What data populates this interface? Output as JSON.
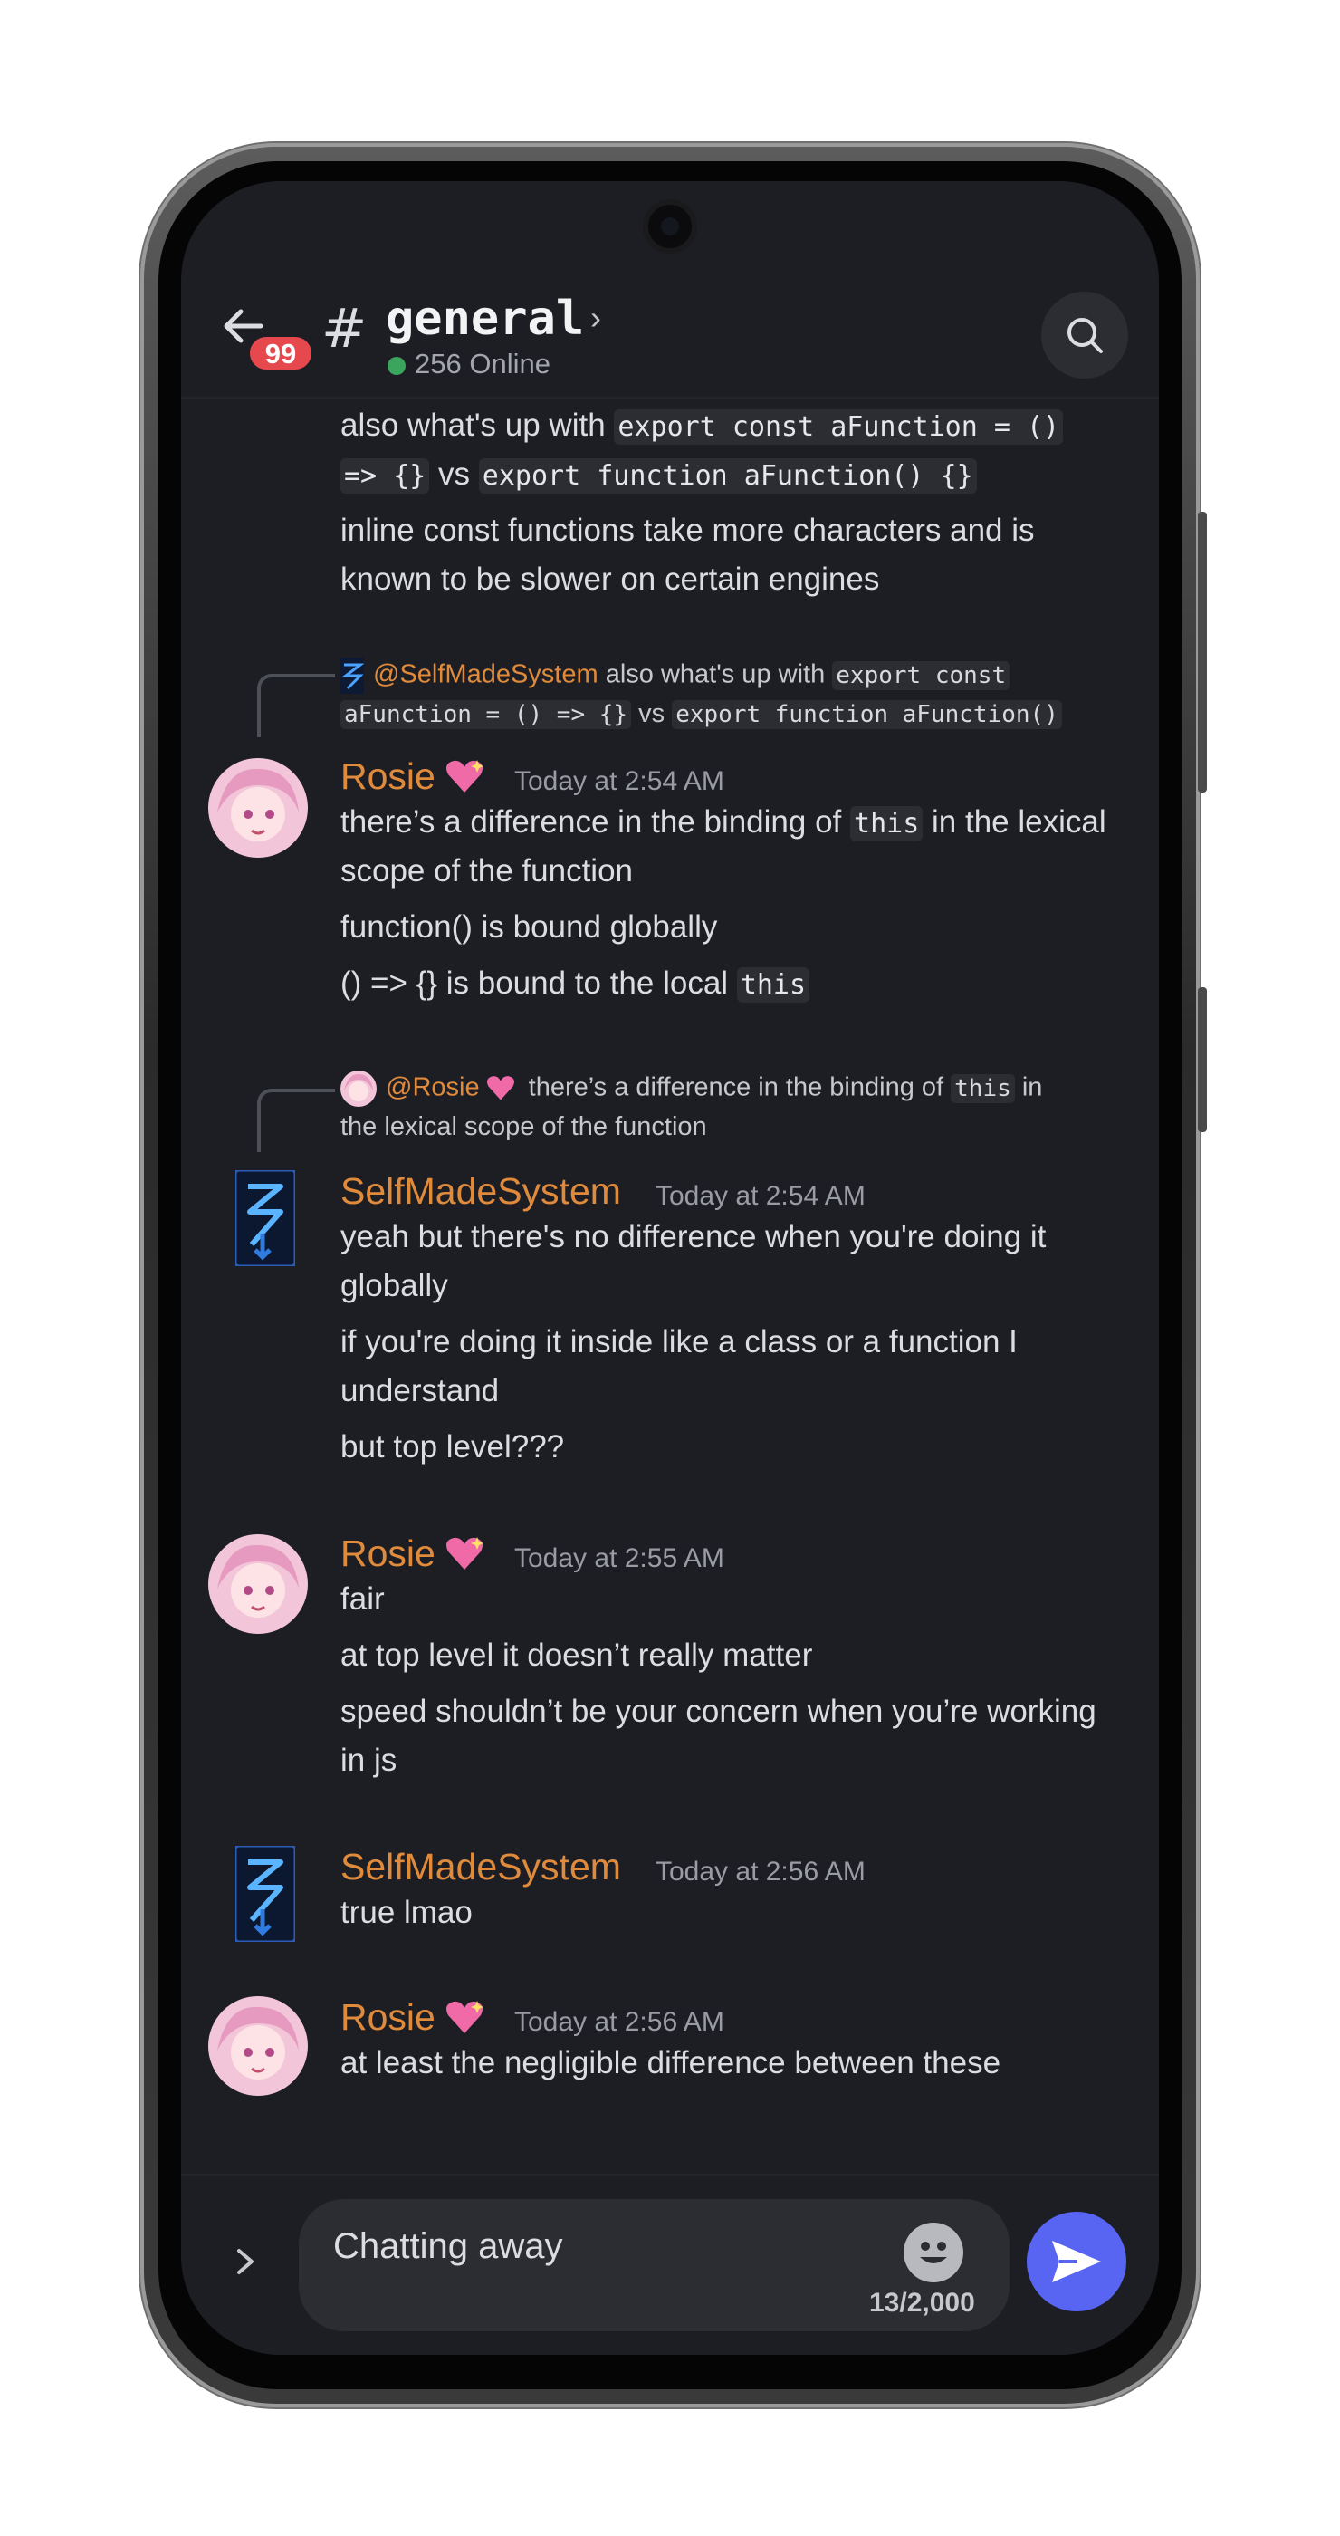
{
  "header": {
    "back_badge": "99",
    "channel_hash": "#",
    "channel_name": "general",
    "chevron": "›",
    "online_count": "256 Online"
  },
  "messages": {
    "top_continuation": {
      "line1_text": "also what's up with",
      "line1_code": "export const aFunction = ()",
      "line2_code_a": "=> {}",
      "line2_vs": "vs",
      "line2_code_b": "export function aFunction() {}",
      "line3": "inline const functions take more characters and is",
      "line4": "known to be slower on certain engines"
    },
    "msg1": {
      "reply_mention": "@SelfMadeSystem",
      "reply_text_a": "also what's up with",
      "reply_code_a": "export const",
      "reply_code_b": "aFunction = () => {}",
      "reply_vs": "vs",
      "reply_code_c": "export function aFunction()",
      "author": "Rosie",
      "time": "Today at 2:54 AM",
      "line1_a": "there’s a difference in the binding of",
      "line1_code": "this",
      "line1_b": "in the lexical",
      "line2": "scope of the function",
      "line3": "function() is bound globally",
      "line4_a": "() => {} is bound to the local",
      "line4_code": "this"
    },
    "msg2": {
      "reply_mention": "@Rosie",
      "reply_text_a": "there’s a difference in the binding of",
      "reply_code": "this",
      "reply_text_b": "in",
      "reply_line2": "the lexical scope of the function",
      "author": "SelfMadeSystem",
      "time": "Today at 2:54 AM",
      "line1": "yeah but there's no difference when you're doing it",
      "line2": "globally",
      "line3": "if you're doing it inside like a class or a function I",
      "line4": "understand",
      "line5": "but top level???"
    },
    "msg3": {
      "author": "Rosie",
      "time": "Today at 2:55 AM",
      "line1": "fair",
      "line2": "at top level it doesn’t really matter",
      "line3": "speed shouldn’t be your concern when you’re working",
      "line4": "in js"
    },
    "msg4": {
      "author": "SelfMadeSystem",
      "time": "Today at 2:56 AM",
      "line1": "true lmao"
    },
    "msg5": {
      "author": "Rosie",
      "time": "Today at 2:56 AM",
      "line1": "at least the negligible difference between these"
    }
  },
  "composer": {
    "input_value": "Chatting away",
    "char_count": "13/2,000"
  },
  "colors": {
    "background": "#1d1e24",
    "author_name": "#e08a3c",
    "send_button": "#5865f2",
    "badge": "#e5484d",
    "online": "#3ba55d"
  },
  "icons": [
    "back-arrow-icon",
    "search-icon",
    "chevron-right-icon",
    "sparkling-heart-icon",
    "emoji-icon",
    "send-icon"
  ]
}
